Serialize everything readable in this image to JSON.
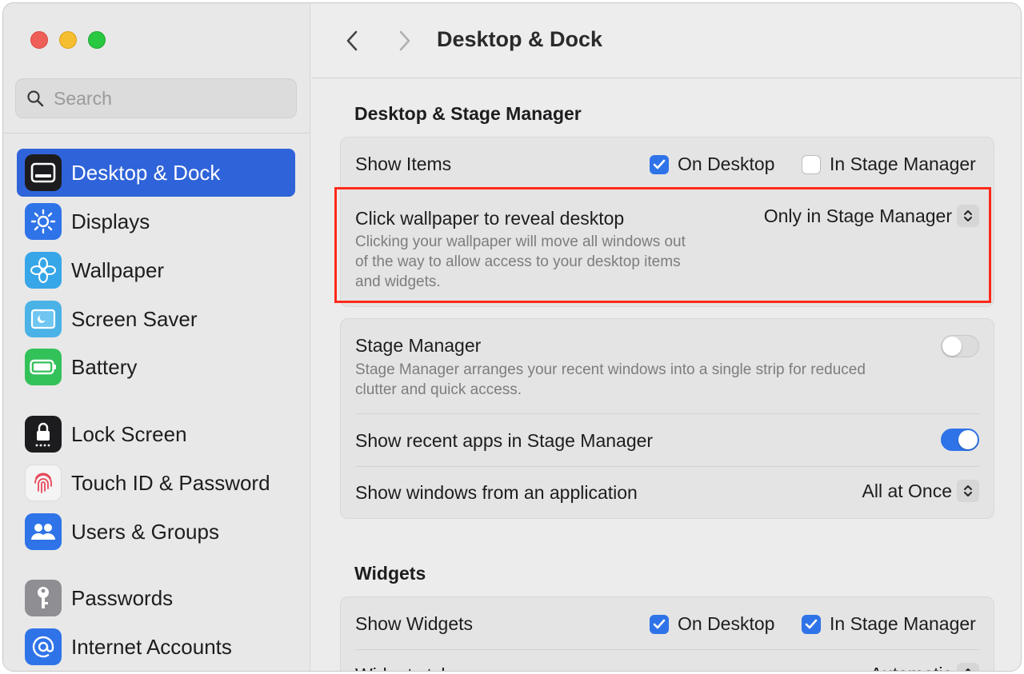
{
  "window": {
    "title": "Desktop & Dock",
    "traffic_lights": [
      "close",
      "minimize",
      "zoom"
    ]
  },
  "sidebar": {
    "search": {
      "placeholder": "Search",
      "value": ""
    },
    "items": [
      {
        "label": "Desktop & Dock",
        "icon": "desktop-dock-icon",
        "active": true,
        "color": "#1c1c1e"
      },
      {
        "label": "Displays",
        "icon": "sun-icon",
        "active": false,
        "color": "#2f73e8"
      },
      {
        "label": "Wallpaper",
        "icon": "flower-icon",
        "active": false,
        "color": "#36a6e8"
      },
      {
        "label": "Screen Saver",
        "icon": "screen-saver-icon",
        "active": false,
        "color": "#4ab2e6"
      },
      {
        "label": "Battery",
        "icon": "battery-icon",
        "active": false,
        "color": "#33c15a"
      },
      {
        "label": "Lock Screen",
        "icon": "lock-icon",
        "active": false,
        "color": "#1c1c1e"
      },
      {
        "label": "Touch ID & Password",
        "icon": "fingerprint-icon",
        "active": false,
        "color": "#f4f4f4"
      },
      {
        "label": "Users & Groups",
        "icon": "users-icon",
        "active": false,
        "color": "#2f73e8"
      },
      {
        "label": "Passwords",
        "icon": "key-icon",
        "active": false,
        "color": "#8e8e93"
      },
      {
        "label": "Internet Accounts",
        "icon": "at-sign-icon",
        "active": false,
        "color": "#2f73e8"
      }
    ]
  },
  "toolbar": {
    "back_icon": "chevron-left-icon",
    "forward_icon": "chevron-right-icon",
    "title": "Desktop & Dock"
  },
  "desktop_stage": {
    "section_title": "Desktop & Stage Manager",
    "show_items": {
      "label": "Show Items",
      "on_desktop": {
        "label": "On Desktop",
        "checked": true
      },
      "in_stage_manager": {
        "label": "In Stage Manager",
        "checked": false
      }
    },
    "click_wallpaper": {
      "label": "Click wallpaper to reveal desktop",
      "description_line1": "Clicking your wallpaper will move all windows out",
      "description_line2": "of the way to allow access to your desktop items",
      "description_line3": "and widgets.",
      "value": "Only in Stage Manager"
    },
    "stage_manager": {
      "label": "Stage Manager",
      "description_line1": "Stage Manager arranges your recent windows into a single strip for reduced",
      "description_line2": "clutter and quick access.",
      "enabled": false
    },
    "recent_apps": {
      "label": "Show recent apps in Stage Manager",
      "enabled": true
    },
    "windows_from_app": {
      "label": "Show windows from an application",
      "value": "All at Once"
    }
  },
  "widgets": {
    "section_title": "Widgets",
    "show_widgets": {
      "label": "Show Widgets",
      "on_desktop": {
        "label": "On Desktop",
        "checked": true
      },
      "in_stage_manager": {
        "label": "In Stage Manager",
        "checked": true
      }
    },
    "widget_style": {
      "label": "Widget style",
      "value": "Automatic"
    }
  },
  "colors": {
    "accent": "#2f73e8",
    "sidebar_active": "#2f63d9",
    "highlight_border": "#ff2a1a"
  }
}
